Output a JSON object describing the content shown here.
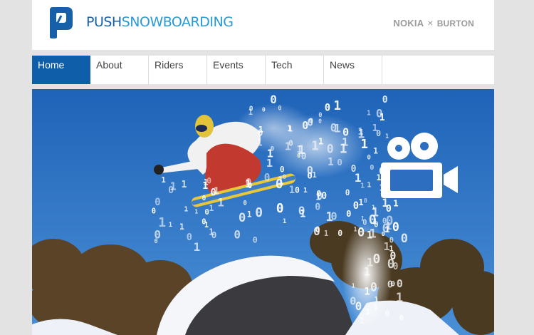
{
  "brand": {
    "name_part1": "PUSH",
    "name_part2": "SNOWBOARDING",
    "primary_color": "#1560a8",
    "accent_color": "#2a9ad6"
  },
  "sponsors": {
    "first": "NOKIA",
    "separator": "×",
    "second": "BURTON"
  },
  "nav": {
    "items": [
      {
        "label": "Home",
        "active": true
      },
      {
        "label": "About"
      },
      {
        "label": "Riders"
      },
      {
        "label": "Events"
      },
      {
        "label": "Tech"
      },
      {
        "label": "News"
      }
    ],
    "active_color": "#0f5eaa"
  },
  "hero": {
    "description_icon": "video-camera-icon",
    "sky_color": "#2a6fc2",
    "binary_digits": [
      "0",
      "1"
    ]
  }
}
